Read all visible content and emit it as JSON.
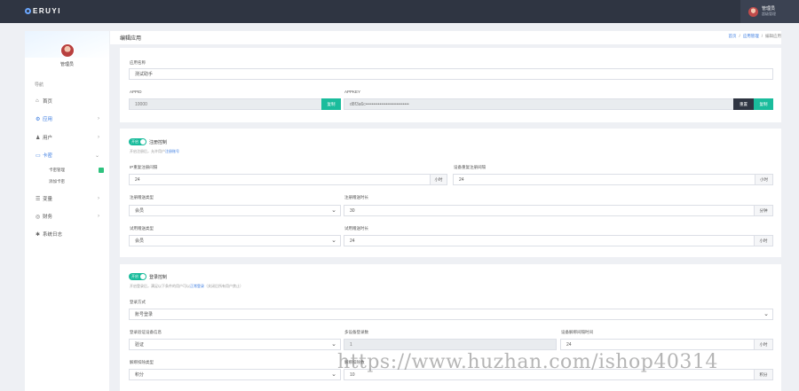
{
  "topbar": {
    "logo": "ERUYI",
    "user_name": "管理员",
    "user_role": "超级管理"
  },
  "sidebar": {
    "user_name": "管理员",
    "nav_title": "导航",
    "items": [
      {
        "label": "首页",
        "icon": "home-icon",
        "glyph": "⌂"
      },
      {
        "label": "应用",
        "icon": "app-icon",
        "glyph": "⚙",
        "chevron": "›"
      },
      {
        "label": "用户",
        "icon": "user-icon",
        "glyph": "♟",
        "chevron": "›"
      },
      {
        "label": "卡密",
        "icon": "card-icon",
        "glyph": "▭",
        "chevron": "⌄"
      },
      {
        "label": "变量",
        "icon": "variable-icon",
        "glyph": "☰",
        "chevron": "›"
      },
      {
        "label": "财务",
        "icon": "finance-icon",
        "glyph": "◎",
        "chevron": "›"
      },
      {
        "label": "系统日志",
        "icon": "log-icon",
        "glyph": "✱"
      }
    ],
    "sub_items": [
      {
        "label": "卡密管理"
      },
      {
        "label": "添加卡密"
      }
    ]
  },
  "header": {
    "title": "编辑应用",
    "crumbs": [
      "首页",
      "/",
      "应用管理",
      "/",
      "编辑应用"
    ]
  },
  "basic": {
    "name_label": "应用名称",
    "name_value": "测试助手",
    "appid_label": "APPID",
    "appid_value": "10000",
    "appid_button": "复制",
    "appkey_label": "APPKEY",
    "appkey_value": "d8f3a6c••••••••••••••••••••••••••••",
    "appkey_reset": "重置",
    "appkey_copy": "复制"
  },
  "register": {
    "toggle_text": "开启",
    "title": "注册控制",
    "hint_prefix": "开启注册后，允许用户",
    "hint_link": "注册账号",
    "ip_interval_label": "IP重复注册间隔",
    "ip_interval_value": "24",
    "ip_interval_unit": "小时",
    "device_interval_label": "设备重复注册间隔",
    "device_interval_value": "24",
    "device_interval_unit": "小时",
    "reg_gift_type_label": "注册赠送类型",
    "reg_gift_type_value": "会员",
    "reg_gift_amount_label": "注册赠送时长",
    "reg_gift_amount_value": "30",
    "reg_gift_amount_unit": "分钟",
    "trial_type_label": "试用赠送类型",
    "trial_type_value": "会员",
    "trial_amount_label": "试用赠送时长",
    "trial_amount_value": "24",
    "trial_amount_unit": "小时"
  },
  "login": {
    "toggle_text": "开启",
    "title": "登录控制",
    "hint_prefix": "开启登录后，满足以下条件的用户可以",
    "hint_link": "正常登录",
    "hint_suffix": "（关闭后所有用户禁止）",
    "mode_label": "登录方式",
    "mode_value": "账号登录",
    "verify_label": "登录验证设备信息",
    "verify_value": "验证",
    "max_devices_label": "多设备登录数",
    "max_devices_value": "1",
    "unbind_label": "设备解绑间隔时间",
    "unbind_value": "24",
    "unbind_unit": "小时",
    "unbind_deduct_label": "解绑扣除类型",
    "unbind_deduct_value": "积分",
    "deduct_amount_label": "解绑扣除数",
    "deduct_amount_value": "10",
    "deduct_amount_unit": "积分"
  },
  "watermark": "https://www.huzhan.com/ishop40314",
  "colors": {
    "accent": "#1abc9c",
    "link": "#3a7be0",
    "topbar": "#2f3542"
  }
}
